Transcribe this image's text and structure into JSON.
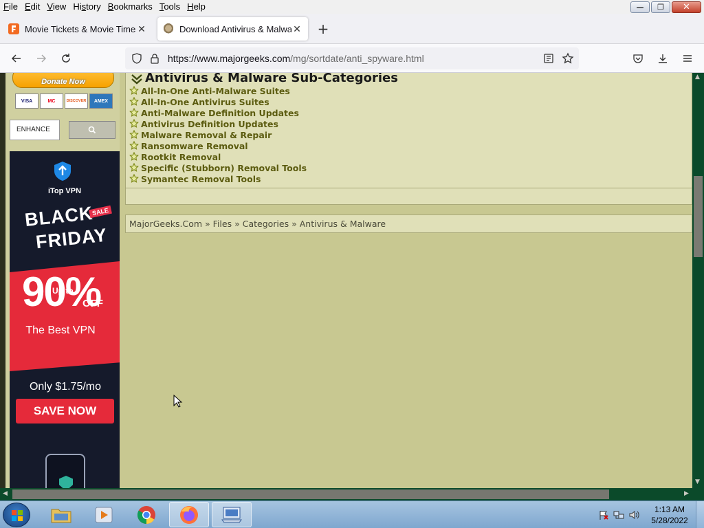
{
  "menubar": {
    "items": [
      {
        "pre": "",
        "u": "F",
        "post": "ile"
      },
      {
        "pre": "",
        "u": "E",
        "post": "dit"
      },
      {
        "pre": "",
        "u": "V",
        "post": "iew"
      },
      {
        "pre": "Hi",
        "u": "s",
        "post": "tory"
      },
      {
        "pre": "",
        "u": "B",
        "post": "ookmarks"
      },
      {
        "pre": "",
        "u": "T",
        "post": "ools"
      },
      {
        "pre": "",
        "u": "H",
        "post": "elp"
      }
    ]
  },
  "tabs": [
    {
      "label": "Movie Tickets & Movie Times | F",
      "icon": "fandango-favicon",
      "active": false
    },
    {
      "label": "Download Antivirus & Malware",
      "icon": "majorgeeks-favicon",
      "active": true
    }
  ],
  "navbar": {
    "url_domain": "https://www.majorgeeks.com",
    "url_path": "/mg/sortdate/anti_spyware.html"
  },
  "sidebar": {
    "paypal_label": "Donate Now",
    "cards": [
      "VISA",
      "MC",
      "DISCOVER",
      "AMEX"
    ],
    "search_value": "ENHANCE"
  },
  "ad": {
    "brand": "iTop VPN",
    "headline_1": "BLACK",
    "headline_2": "FRIDAY",
    "sale": "SALE",
    "upto": "Up to",
    "discount": "90%",
    "off": "OFF",
    "tagline": "The Best VPN",
    "price": "Only $1.75/mo",
    "cta": "SAVE NOW"
  },
  "main": {
    "subcategories_title": "Antivirus & Malware Sub-Categories",
    "subcategories": [
      "All-In-One Anti-Malware Suites",
      "All-In-One Antivirus Suites",
      "Anti-Malware Definition Updates",
      "Antivirus Definition Updates",
      "Malware Removal & Repair",
      "Ransomware Removal",
      "Rootkit Removal",
      "Specific (Stubborn) Removal Tools",
      "Symantec Removal Tools"
    ],
    "breadcrumb": [
      "MajorGeeks.Com",
      "Files",
      "Categories",
      "Antivirus & Malware"
    ]
  },
  "taskbar": {
    "apps": [
      "explorer",
      "media-player",
      "chrome",
      "firefox",
      "remote-desktop"
    ],
    "time": "1:13 AM",
    "date": "5/28/2022"
  }
}
